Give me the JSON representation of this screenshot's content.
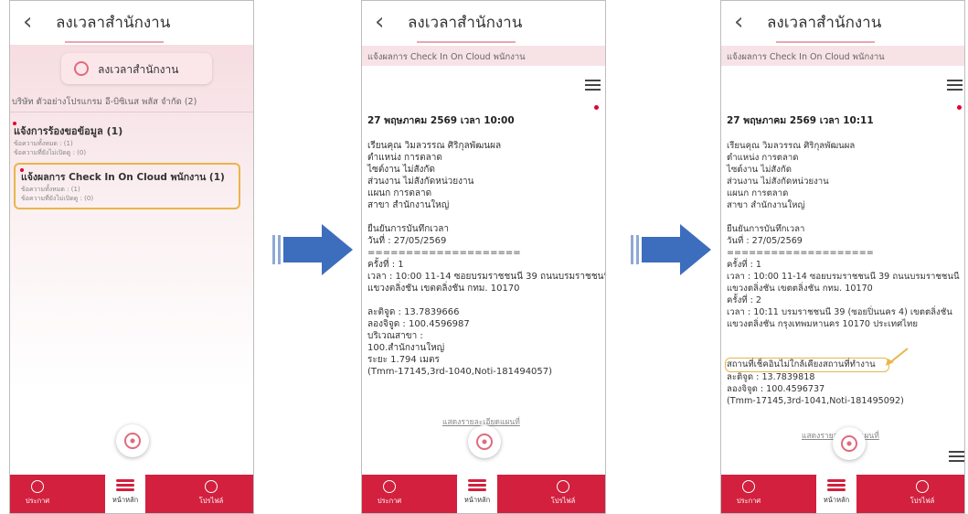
{
  "app": {
    "title": "ลงเวลาสำนักงาน",
    "back_icon": "chevron-left-icon",
    "menu_icon": "hamburger-menu-icon"
  },
  "colors": {
    "brand": "#d2203e",
    "highlight": "#e8b64a",
    "arrow": "#3d6dbd",
    "badge": "#e3002b"
  },
  "panel1": {
    "pill_label": "ลงเวลาสำนักงาน",
    "company": "บริษัท ตัวอย่างโปรแกรม อี-บิซิเนส พลัส จำกัด (2)",
    "cards": [
      {
        "title": "แจ้งการร้องขอข้อมูล (1)",
        "line1": "ข้อความทั้งหมด : (1)",
        "line2": "ข้อความที่ยังไม่เปิดดู : (0)"
      },
      {
        "title": "แจ้งผลการ Check In On Cloud พนักงาน (1)",
        "line1": "ข้อความทั้งหมด : (1)",
        "line2": "ข้อความที่ยังไม่เปิดดู : (0)"
      }
    ]
  },
  "panel2": {
    "notice": "แจ้งผลการ Check In On Cloud พนักงาน",
    "date": "27 พฤษภาคม 2569 เวลา 10:00",
    "body": "เรียนคุณ วิมลวรรณ ศิริกุลพัฒนผล\nตำแหน่ง การตลาด\nไซต์งาน ไม่สังกัด\nส่วนงาน ไม่สังกัดหน่วยงาน\nแผนก การตลาด\nสาขา สำนักงานใหญ่\n\nยืนยันการบันทึกเวลา\nวันที่ : 27/05/2569\n====================\nครั้งที่ : 1\nเวลา : 10:00 11-14 ซอยบรมราชชนนี 39 ถนนบรมราชชนนี\nแขวงตลิ่งชัน เขตตลิ่งชัน กทม. 10170\n\nละติจูด : 13.7839666\nลองจิจูด : 100.4596987\nบริเวณสาขา :\n100.สำนักงานใหญ่\nระยะ 1.794 เมตร\n(Tmm-17145,3rd-1040,Noti-181494057)",
    "map_link": "แสดงรายละเอียดแผนที่"
  },
  "panel3": {
    "notice": "แจ้งผลการ Check In On Cloud พนักงาน",
    "date": "27 พฤษภาคม 2569 เวลา 10:11",
    "body": "เรียนคุณ วิมลวรรณ ศิริกุลพัฒนผล\nตำแหน่ง การตลาด\nไซต์งาน ไม่สังกัด\nส่วนงาน ไม่สังกัดหน่วยงาน\nแผนก การตลาด\nสาขา สำนักงานใหญ่\n\nยืนยันการบันทึกเวลา\nวันที่ : 27/05/2569\n====================\nครั้งที่ : 1\nเวลา : 10:00 11-14 ซอยบรมราชชนนี 39 ถนนบรมราชชนนี\nแขวงตลิ่งชัน เขตตลิ่งชัน กทม. 10170\nครั้งที่ : 2\nเวลา : 10:11 บรมราชชนนี 39 (ซอยปิ่นนคร 4) เขตตลิ่งชัน\nแขวงตลิ่งชัน กรุงเทพมหานคร 10170 ประเทศไทย",
    "warning": "สถานที่เช็คอินไม่ใกล้เคียงสถานที่ทำงาน",
    "body2": "ละติจูด : 13.7839818\nลองจิจูด : 100.4596737\n(Tmm-17145,3rd-1041,Noti-181495092)",
    "map_link": "แสดงรายละเอียดแผนที่"
  },
  "bottom_nav": {
    "items": [
      {
        "label": "ประกาศ",
        "icon": "megaphone-icon"
      },
      {
        "label": "หน้าหลัก",
        "icon": "home-menu-icon"
      },
      {
        "label": "โปรไฟล์",
        "icon": "profile-icon"
      }
    ]
  }
}
